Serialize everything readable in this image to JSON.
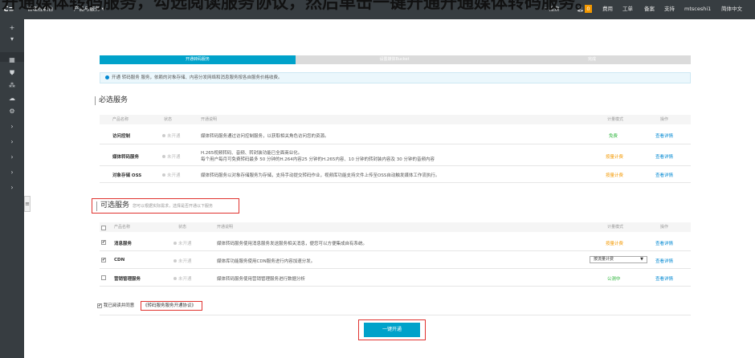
{
  "overlay_text": "开通媒体转码服务，勾选阅读服务协议，然后单击一键开通开通媒体转码服务。",
  "topbar": {
    "logo": "C⊃",
    "console": "管理控制台",
    "products": "产品与服务 ▾",
    "search": "▾ 搜索",
    "bell_icon": "bell-icon",
    "badge": "0",
    "fee": "费用",
    "ticket": "工单",
    "record": "备案",
    "support": "支持",
    "user": "mtsceshi1",
    "lang": "简体中文"
  },
  "steps": [
    "开通转码服务",
    "设置媒体Bucket",
    "完成"
  ],
  "info": "开通 转码服务 服务，依赖的对象存储、内容分发网络和消息服务按各自服务价格收费。",
  "required": {
    "title": "必选服务",
    "headers": [
      "产品名称",
      "状态",
      "开通说明",
      "计量模式",
      "操作"
    ],
    "rows": [
      {
        "name": "访问控制",
        "status": "未开通",
        "desc": [
          "媒体转码服务通过访问控制服务，以获取相关角色访问您的资源。"
        ],
        "mode": "免费",
        "op": "查看详情"
      },
      {
        "name": "媒体转码服务",
        "status": "未开通",
        "desc": [
          "H.265视频转码、音频、转封装功能已全面商业化。",
          "每个用户每月可免费转码最多 50 分钟的H.264内容25 分钟的H.265内容、10 分钟的转封装内容及 30 分钟的音频内容"
        ],
        "mode": "按量计费",
        "op": "查看详情"
      },
      {
        "name": "对象存储 OSS",
        "status": "未开通",
        "desc": [
          "媒体转码服务以对象存储服务为存储，支持手动提交转码作业，视频库功能支持文件上传至OSS自动触发媒体工作流执行。"
        ],
        "mode": "按量计费",
        "op": "查看详情"
      }
    ]
  },
  "optional": {
    "title": "可选服务",
    "subtitle": "您可以根据实际需求，选择是否开通以下服务",
    "headers": [
      "产品名称",
      "状态",
      "开通说明",
      "计量模式",
      "操作"
    ],
    "rows": [
      {
        "checked": true,
        "name": "消息服务",
        "status": "未开通",
        "desc": "媒体转码服务使用消息服务发送服务相关消息，便您可以方便集成自有系统。",
        "mode": "按量计费",
        "op": "查看详情"
      },
      {
        "checked": true,
        "name": "CDN",
        "status": "未开通",
        "desc": "媒体库功能服务使用CDN服务进行内容加速分发。",
        "mode": "按流量计费",
        "op": "查看详情"
      },
      {
        "checked": false,
        "name": "营销管理服务",
        "status": "未开通",
        "desc": "媒体转码服务使用营销管理服务进行数据分析",
        "mode": "公测中",
        "op": "查看详情"
      }
    ]
  },
  "agree": {
    "prefix": "我已阅读并同意",
    "link": "《转码服务服务开通协议》"
  },
  "submit": "一键开通",
  "colors": {
    "accent": "#00a2ca",
    "free": "#2bb43a",
    "metered": "#f39800",
    "link": "#0088d2",
    "highlight": "#e0332f"
  }
}
